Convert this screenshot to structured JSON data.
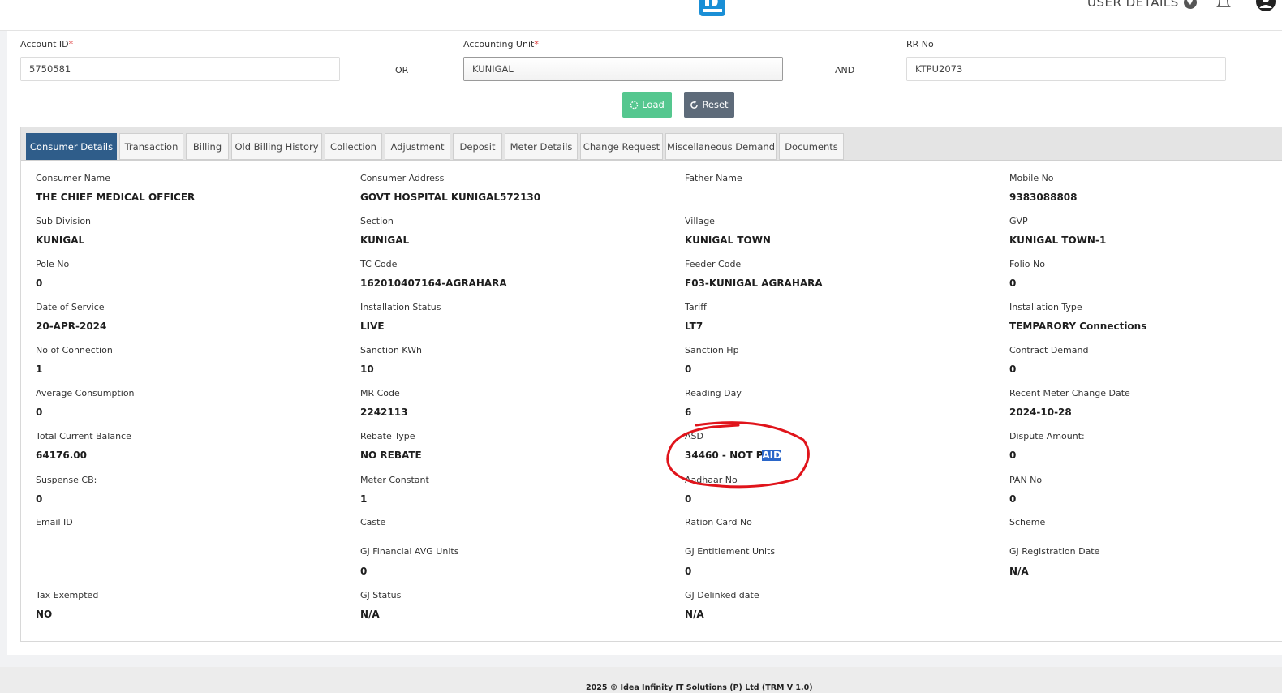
{
  "header": {
    "user_details_label": "USER DETAILS",
    "brand_color": "#1a8fd6"
  },
  "search": {
    "account_id_label": "Account ID",
    "account_id_value": "5750581",
    "or_label": "OR",
    "accounting_unit_label": "Accounting Unit",
    "accounting_unit_value": "KUNIGAL",
    "and_label": "AND",
    "rr_no_label": "RR No",
    "rr_no_value": "KTPU2073",
    "required_mark": "*",
    "load_label": "Load",
    "reset_label": "Reset"
  },
  "tabs": [
    {
      "label": "Consumer Details",
      "active": true
    },
    {
      "label": "Transaction"
    },
    {
      "label": "Billing"
    },
    {
      "label": "Old Billing History"
    },
    {
      "label": "Collection"
    },
    {
      "label": "Adjustment"
    },
    {
      "label": "Deposit"
    },
    {
      "label": "Meter Details"
    },
    {
      "label": "Change Request"
    },
    {
      "label": "Miscellaneous Demand"
    },
    {
      "label": "Documents"
    }
  ],
  "fields": {
    "consumer_name": {
      "label": "Consumer Name",
      "value": "THE CHIEF MEDICAL OFFICER"
    },
    "consumer_address": {
      "label": "Consumer Address",
      "value": "GOVT HOSPITAL KUNIGAL572130"
    },
    "father_name": {
      "label": "Father Name",
      "value": ""
    },
    "mobile_no": {
      "label": "Mobile No",
      "value": "9383088808"
    },
    "sub_division": {
      "label": "Sub Division",
      "value": "KUNIGAL"
    },
    "section": {
      "label": "Section",
      "value": "KUNIGAL"
    },
    "village": {
      "label": "Village",
      "value": "KUNIGAL TOWN"
    },
    "gvp": {
      "label": "GVP",
      "value": "KUNIGAL TOWN-1"
    },
    "pole_no": {
      "label": "Pole No",
      "value": "0"
    },
    "tc_code": {
      "label": "TC Code",
      "value": "162010407164-AGRAHARA"
    },
    "feeder_code": {
      "label": "Feeder Code",
      "value": "F03-KUNIGAL AGRAHARA"
    },
    "folio_no": {
      "label": "Folio No",
      "value": "0"
    },
    "date_of_service": {
      "label": "Date of Service",
      "value": "20-APR-2024"
    },
    "installation_status": {
      "label": "Installation Status",
      "value": "LIVE"
    },
    "tariff": {
      "label": "Tariff",
      "value": "LT7"
    },
    "installation_type": {
      "label": "Installation Type",
      "value": "TEMPARORY Connections"
    },
    "no_of_connection": {
      "label": "No of Connection",
      "value": "1"
    },
    "sanction_kwh": {
      "label": "Sanction KWh",
      "value": "10"
    },
    "sanction_hp": {
      "label": "Sanction Hp",
      "value": "0"
    },
    "contract_demand": {
      "label": "Contract Demand",
      "value": "0"
    },
    "average_consumption": {
      "label": "Average Consumption",
      "value": "0"
    },
    "mr_code": {
      "label": "MR Code",
      "value": "2242113"
    },
    "reading_day": {
      "label": "Reading Day",
      "value": "6"
    },
    "recent_meter_change_date": {
      "label": "Recent Meter Change Date",
      "value": "2024-10-28"
    },
    "total_current_balance": {
      "label": "Total Current Balance",
      "value": "64176.00"
    },
    "rebate_type": {
      "label": "Rebate Type",
      "value": "NO REBATE"
    },
    "asd": {
      "label": "ASD",
      "value_plain": "34460 - NOT P",
      "value_highlight": "AID"
    },
    "dispute_amount": {
      "label": "Dispute Amount:",
      "value": "0"
    },
    "suspense_cb": {
      "label": "Suspense CB:",
      "value": "0"
    },
    "meter_constant": {
      "label": "Meter Constant",
      "value": "1"
    },
    "aadhaar_no": {
      "label": "Aadhaar No",
      "value": "0"
    },
    "pan_no": {
      "label": "PAN No",
      "value": "0"
    },
    "email_id": {
      "label": "Email ID",
      "value": ""
    },
    "caste": {
      "label": "Caste",
      "value": ""
    },
    "ration_card_no": {
      "label": "Ration Card No",
      "value": ""
    },
    "scheme": {
      "label": "Scheme",
      "value": ""
    },
    "gj_financial_avg_units": {
      "label": "GJ Financial AVG Units",
      "value": "0"
    },
    "gj_entitlement_units": {
      "label": "GJ Entitlement Units",
      "value": "0"
    },
    "gj_registration_date": {
      "label": "GJ Registration Date",
      "value": "N/A"
    },
    "tax_exempted": {
      "label": "Tax Exempted",
      "value": "NO"
    },
    "gj_status": {
      "label": "GJ Status",
      "value": "N/A"
    },
    "gj_delinked_date": {
      "label": "GJ Delinked date",
      "value": "N/A"
    }
  },
  "footer": {
    "text": "2025 © Idea Infinity IT Solutions (P) Ltd (TRM V 1.0)"
  },
  "annotation": {
    "color": "#e0141b"
  }
}
